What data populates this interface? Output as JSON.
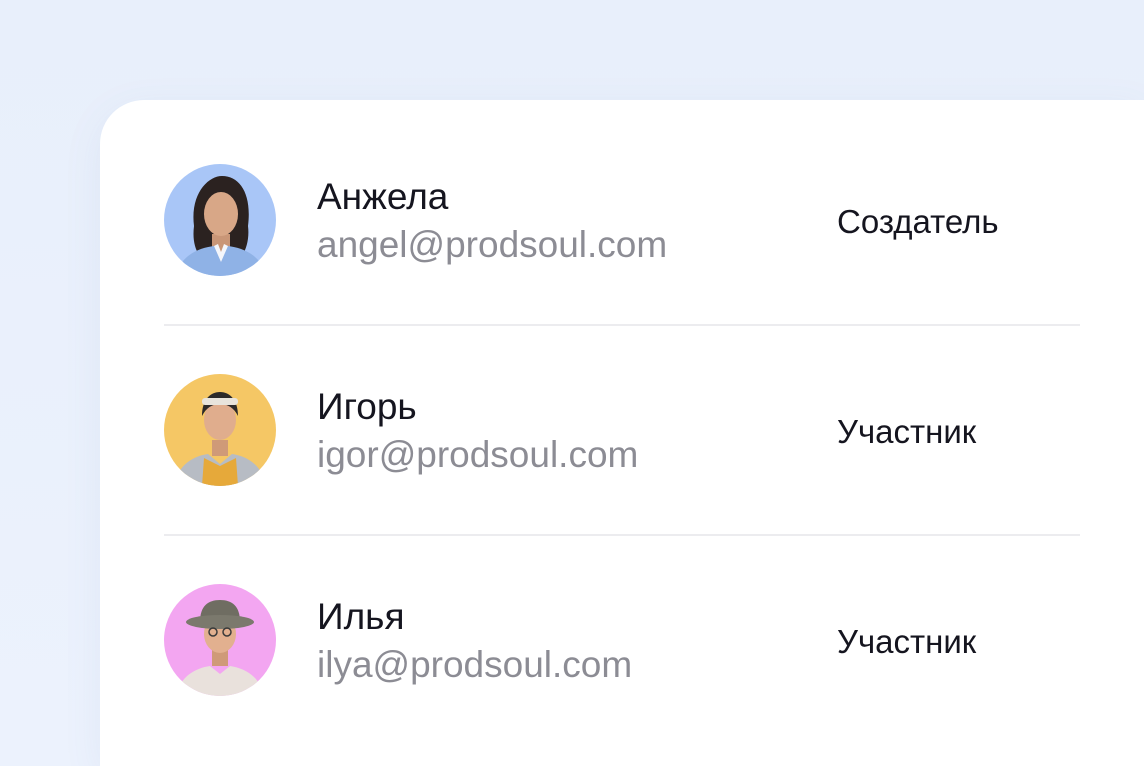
{
  "members": [
    {
      "name": "Анжела",
      "email": "angel@prodsoul.com",
      "role": "Создатель",
      "avatar_bg": "#a9c6f7"
    },
    {
      "name": "Игорь",
      "email": "igor@prodsoul.com",
      "role": "Участник",
      "avatar_bg": "#f5c765"
    },
    {
      "name": "Илья",
      "email": "ilya@prodsoul.com",
      "role": "Участник",
      "avatar_bg": "#f3a6f1"
    }
  ],
  "colors": {
    "page_background": "#e9f0fc",
    "card_background": "#ffffff",
    "name_text": "#15151f",
    "email_text": "#8c8c94",
    "divider": "#ececef"
  }
}
